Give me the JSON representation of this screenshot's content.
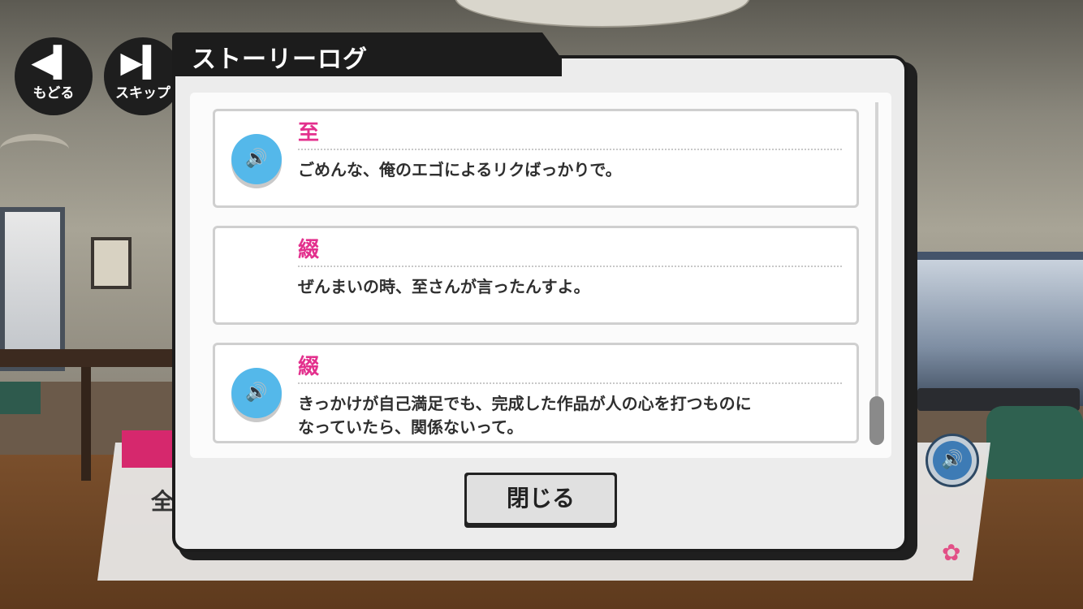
{
  "controls": {
    "back_label": "もどる",
    "skip_label": "スキップ"
  },
  "background": {
    "speaker_initial": "全"
  },
  "modal": {
    "title": "ストーリーログ",
    "close_label": "閉じる"
  },
  "log": [
    {
      "speaker": "至",
      "text": "ごめんな、俺のエゴによるリクばっかりで。",
      "has_voice": true
    },
    {
      "speaker": "綴",
      "text": "ぜんまいの時、至さんが言ったんすよ。",
      "has_voice": false
    },
    {
      "speaker": "綴",
      "text": "きっかけが自己満足でも、完成した作品が人の心を打つものに\nなっていたら、関係ないって。",
      "has_voice": true
    }
  ],
  "colors": {
    "speaker_name": "#e3308d",
    "voice_button": "#54b8ea",
    "frame": "#1c1c1c"
  },
  "icons": {
    "back": "rewind-icon",
    "skip": "skip-forward-icon",
    "voice": "speaker-icon"
  }
}
